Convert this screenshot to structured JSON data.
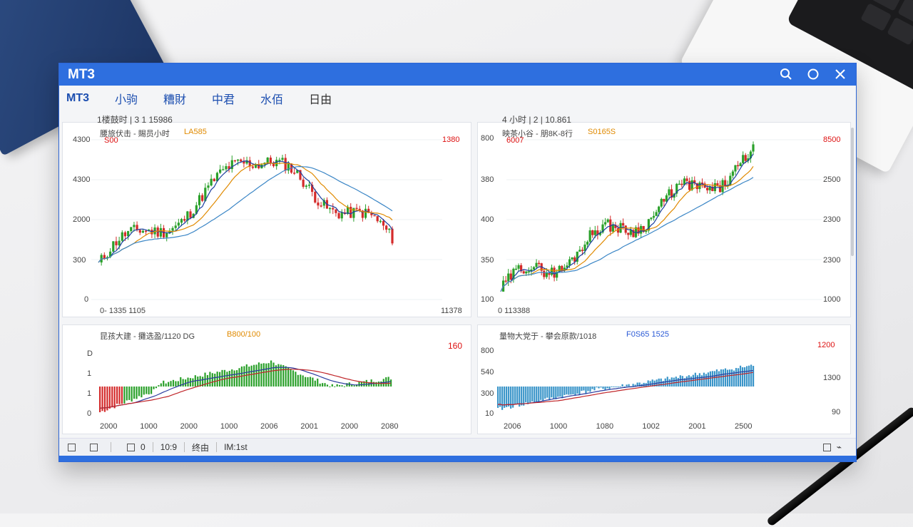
{
  "window": {
    "title": "MT3"
  },
  "menu": [
    "MT3",
    "小驹",
    "糟財",
    "中君",
    "水佰",
    "日由"
  ],
  "charts": {
    "tl": {
      "header": "1楼鼓时 | 3 1 15986",
      "legend_a": "腰旅伏击 - 賜员小时",
      "legend_b": "LA585",
      "legend_c": "S00",
      "right_top": "1380",
      "y_ticks": [
        "4300",
        "4300",
        "2000",
        "300",
        "0"
      ],
      "x_left": "0- 1335 1105",
      "x_right": "11378"
    },
    "tr": {
      "header": "4 小时 | 2 | 10.861",
      "legend_a": "映茶小谷 - 朋8K-8行",
      "legend_b": "S0165S",
      "legend_c": "6007",
      "y_left": [
        "800",
        "380",
        "400",
        "350",
        "100"
      ],
      "y_right": [
        "8500",
        "2500",
        "2300",
        "2300",
        "1000"
      ],
      "x_left": "0 113388"
    },
    "bl": {
      "legend_a": "昆孩大建 - 攤选盈/1120 DG",
      "legend_b": "B800/100",
      "right_top": "160",
      "y_ticks": [
        "D",
        "1",
        "1",
        "0"
      ],
      "x_labels": [
        "2000",
        "1000",
        "2000",
        "1000",
        "2006",
        "2001",
        "2000",
        "2080"
      ]
    },
    "br": {
      "legend_a": "量物大党于 - 攀会原款/1018",
      "legend_b": "F0S65 1525",
      "y_left": [
        "800",
        "540",
        "300",
        "10"
      ],
      "y_right": [
        "1200",
        "1300",
        "90"
      ],
      "x_labels": [
        "2006",
        "1000",
        "1080",
        "1002",
        "2001",
        "2500"
      ]
    }
  },
  "status": {
    "a": "0",
    "b": "10:9",
    "c": "终由",
    "d": "IM:1st"
  },
  "colors": {
    "titlebar": "#2e6fdf",
    "up": "#2aa02a",
    "down": "#d42a2a",
    "ma1": "#1c3fa0",
    "ma2": "#e08a00",
    "ma3": "#3b86c6",
    "hist_blue": "#3a95c9"
  }
}
